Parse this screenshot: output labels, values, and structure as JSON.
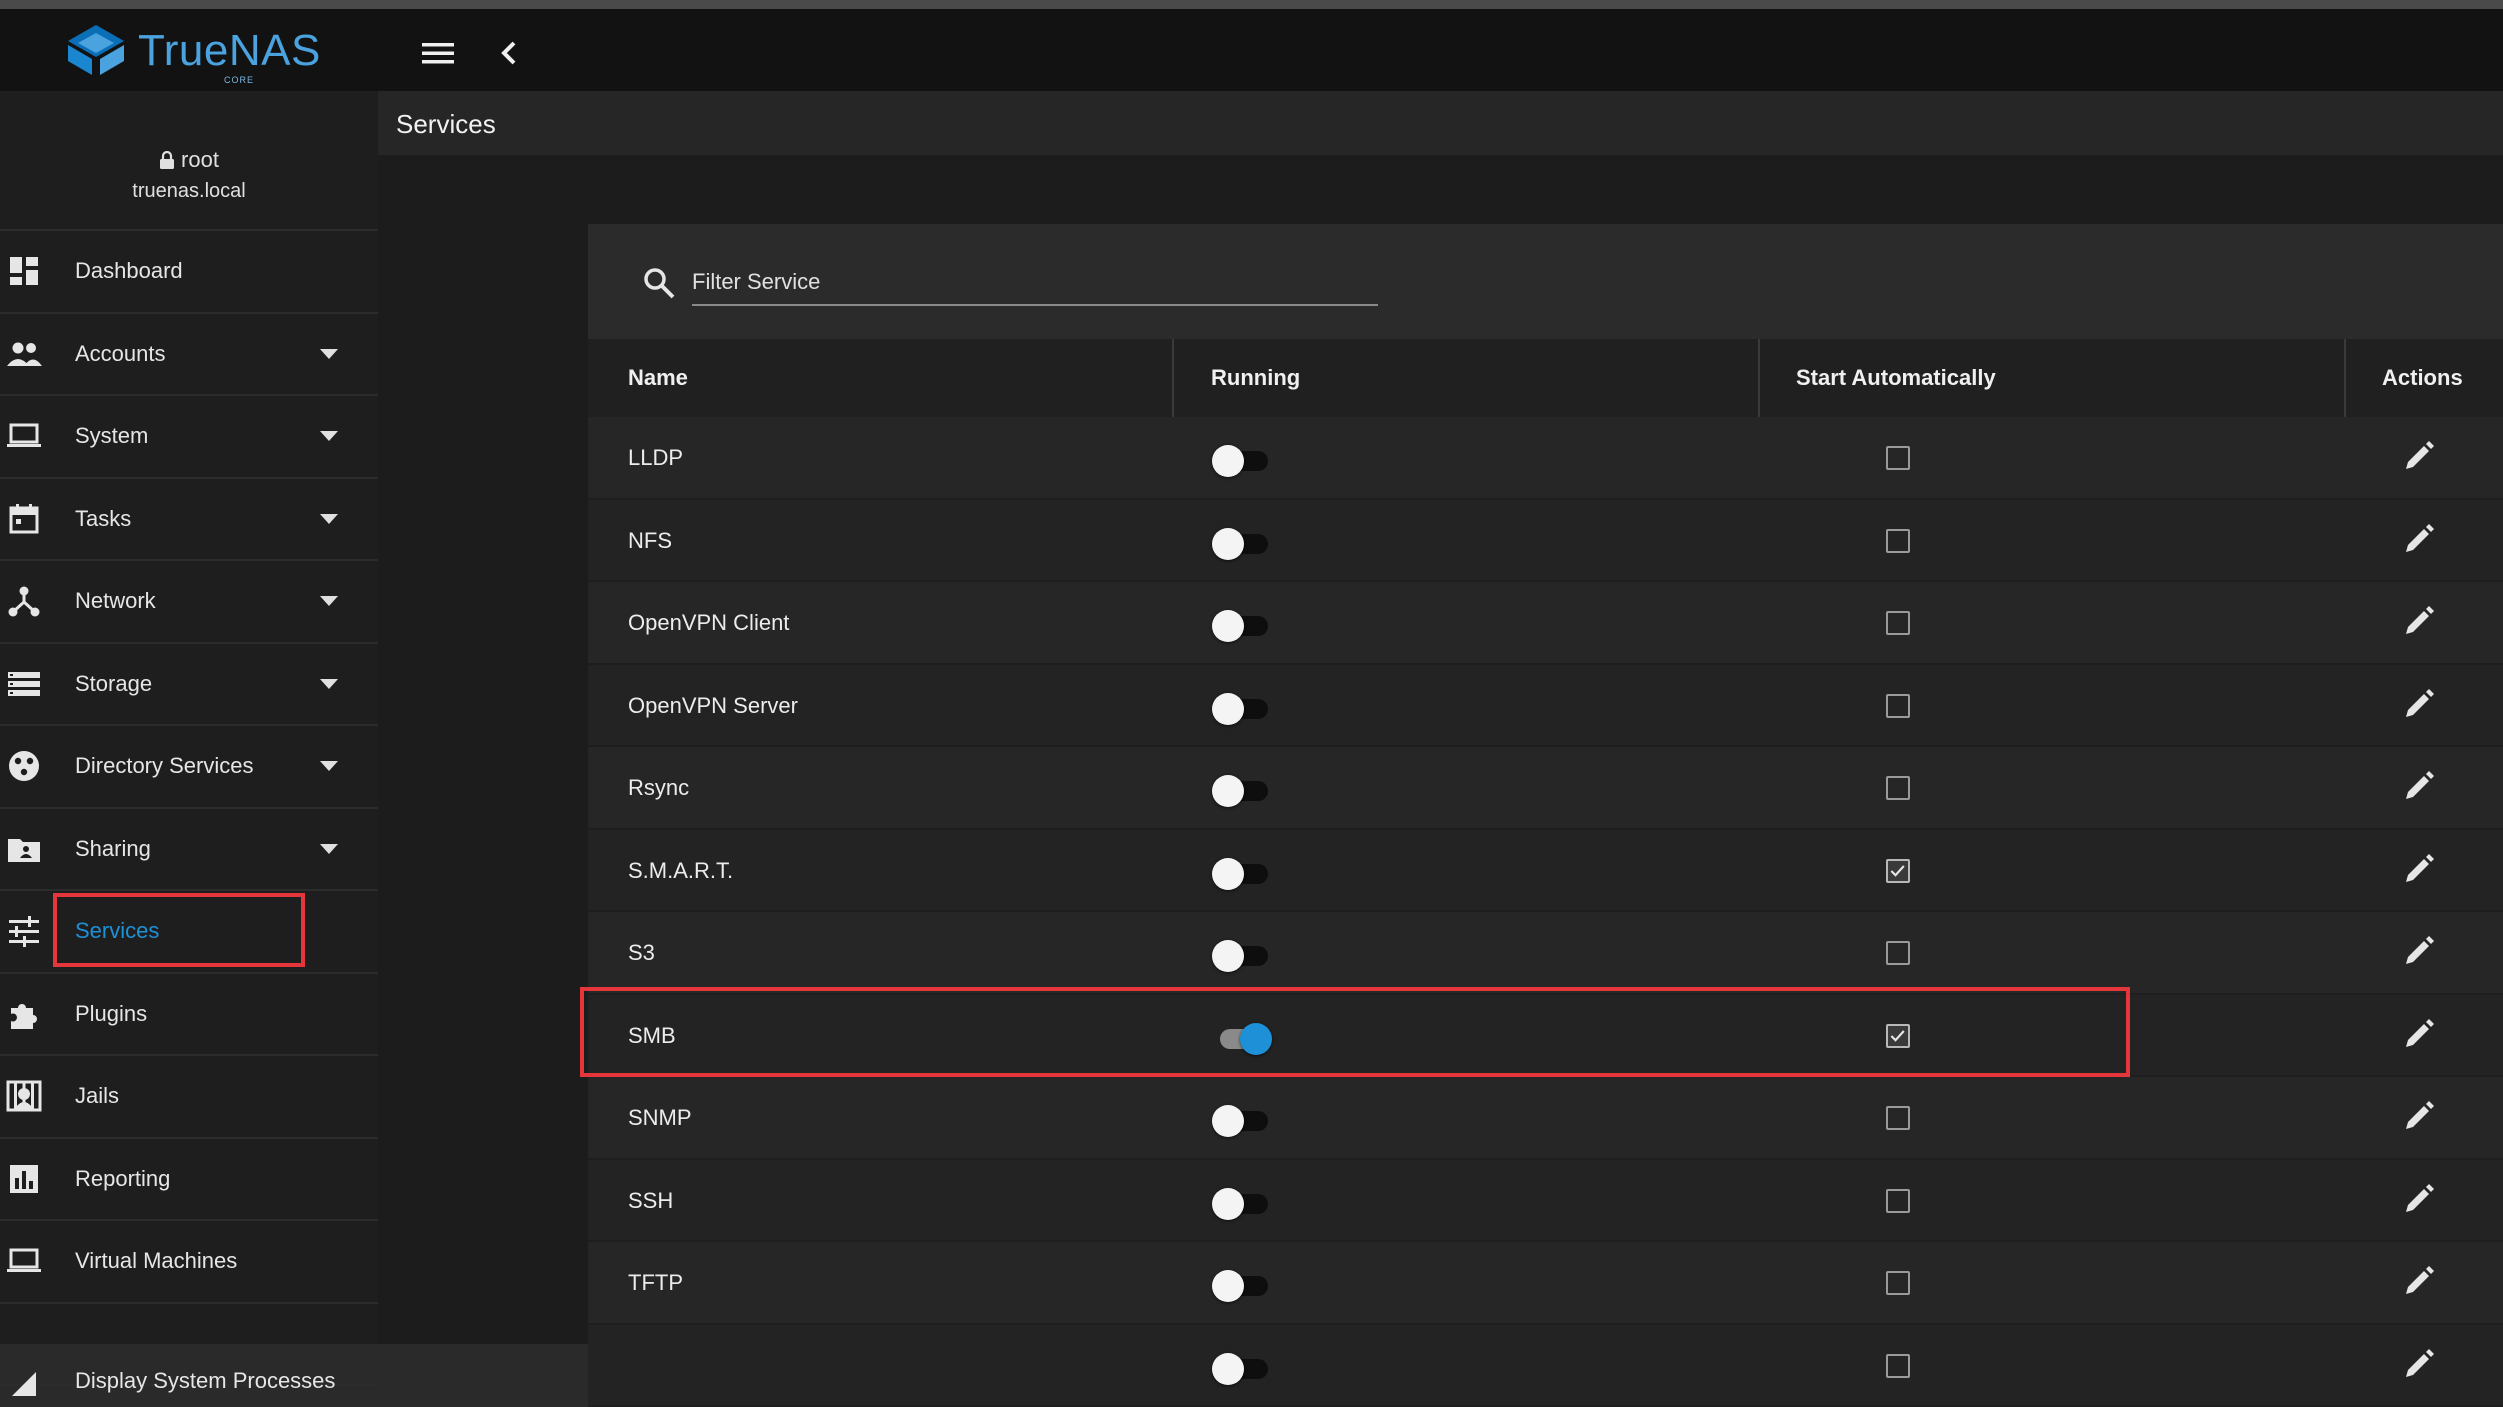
{
  "app": {
    "brand_name": "TrueNAS",
    "brand_sub": "CORE",
    "brand_color": "#4aa3df",
    "accent_color": "#1e90d8",
    "highlight_color": "#e5363b"
  },
  "topbar": {
    "menu_icon": "hamburger-menu-icon",
    "collapse_icon": "chevron-left-icon"
  },
  "user": {
    "name": "root",
    "host": "truenas.local",
    "icon": "lock-icon"
  },
  "sidebar": {
    "items": [
      {
        "label": "Dashboard",
        "icon": "dashboard-icon",
        "has_caret": false
      },
      {
        "label": "Accounts",
        "icon": "users-icon",
        "has_caret": true
      },
      {
        "label": "System",
        "icon": "laptop-icon",
        "has_caret": true
      },
      {
        "label": "Tasks",
        "icon": "calendar-icon",
        "has_caret": true
      },
      {
        "label": "Network",
        "icon": "network-icon",
        "has_caret": true
      },
      {
        "label": "Storage",
        "icon": "storage-icon",
        "has_caret": true
      },
      {
        "label": "Directory Services",
        "icon": "directory-icon",
        "has_caret": true
      },
      {
        "label": "Sharing",
        "icon": "folder-share-icon",
        "has_caret": true
      },
      {
        "label": "Services",
        "icon": "tune-icon",
        "has_caret": false,
        "active": true
      },
      {
        "label": "Plugins",
        "icon": "puzzle-icon",
        "has_caret": false
      },
      {
        "label": "Jails",
        "icon": "jail-icon",
        "has_caret": false
      },
      {
        "label": "Reporting",
        "icon": "bar-chart-icon",
        "has_caret": false
      },
      {
        "label": "Virtual Machines",
        "icon": "laptop-icon",
        "has_caret": false
      },
      {
        "label": "Display System Processes",
        "icon": "processes-icon",
        "has_caret": false
      }
    ]
  },
  "page": {
    "title": "Services"
  },
  "filter": {
    "placeholder": "Filter Service",
    "icon": "search-icon"
  },
  "table": {
    "columns": {
      "name": "Name",
      "running": "Running",
      "start_automatically": "Start Automatically",
      "actions": "Actions"
    },
    "rows": [
      {
        "name": "LLDP",
        "running": false,
        "start_automatically": false
      },
      {
        "name": "NFS",
        "running": false,
        "start_automatically": false
      },
      {
        "name": "OpenVPN Client",
        "running": false,
        "start_automatically": false
      },
      {
        "name": "OpenVPN Server",
        "running": false,
        "start_automatically": false
      },
      {
        "name": "Rsync",
        "running": false,
        "start_automatically": false
      },
      {
        "name": "S.M.A.R.T.",
        "running": false,
        "start_automatically": true
      },
      {
        "name": "S3",
        "running": false,
        "start_automatically": false
      },
      {
        "name": "SMB",
        "running": true,
        "start_automatically": true,
        "highlighted": true
      },
      {
        "name": "SNMP",
        "running": false,
        "start_automatically": false
      },
      {
        "name": "SSH",
        "running": false,
        "start_automatically": false
      },
      {
        "name": "TFTP",
        "running": false,
        "start_automatically": false
      },
      {
        "name": "",
        "running": false,
        "start_automatically": false
      }
    ],
    "action_icon": "pencil-edit-icon"
  }
}
